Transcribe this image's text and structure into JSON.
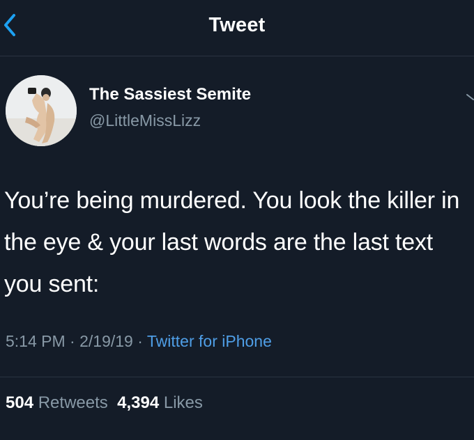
{
  "header": {
    "title": "Tweet",
    "back_icon": "chevron-left-icon"
  },
  "tweet": {
    "author_name": "The Sassiest Semite",
    "handle": "@LittleMissLizz",
    "text": "You’re being murdered. You look the killer in the eye & your last words are the last text you sent:",
    "time": "5:14 PM",
    "date": "2/19/19",
    "separator": "·",
    "source": "Twitter for iPhone",
    "retweets_count": "504",
    "retweets_label": "Retweets",
    "likes_count": "4,394",
    "likes_label": "Likes"
  },
  "colors": {
    "background": "#141c28",
    "secondary_text": "#8899a6",
    "link": "#4f9ee6",
    "accent": "#1da1f2"
  }
}
